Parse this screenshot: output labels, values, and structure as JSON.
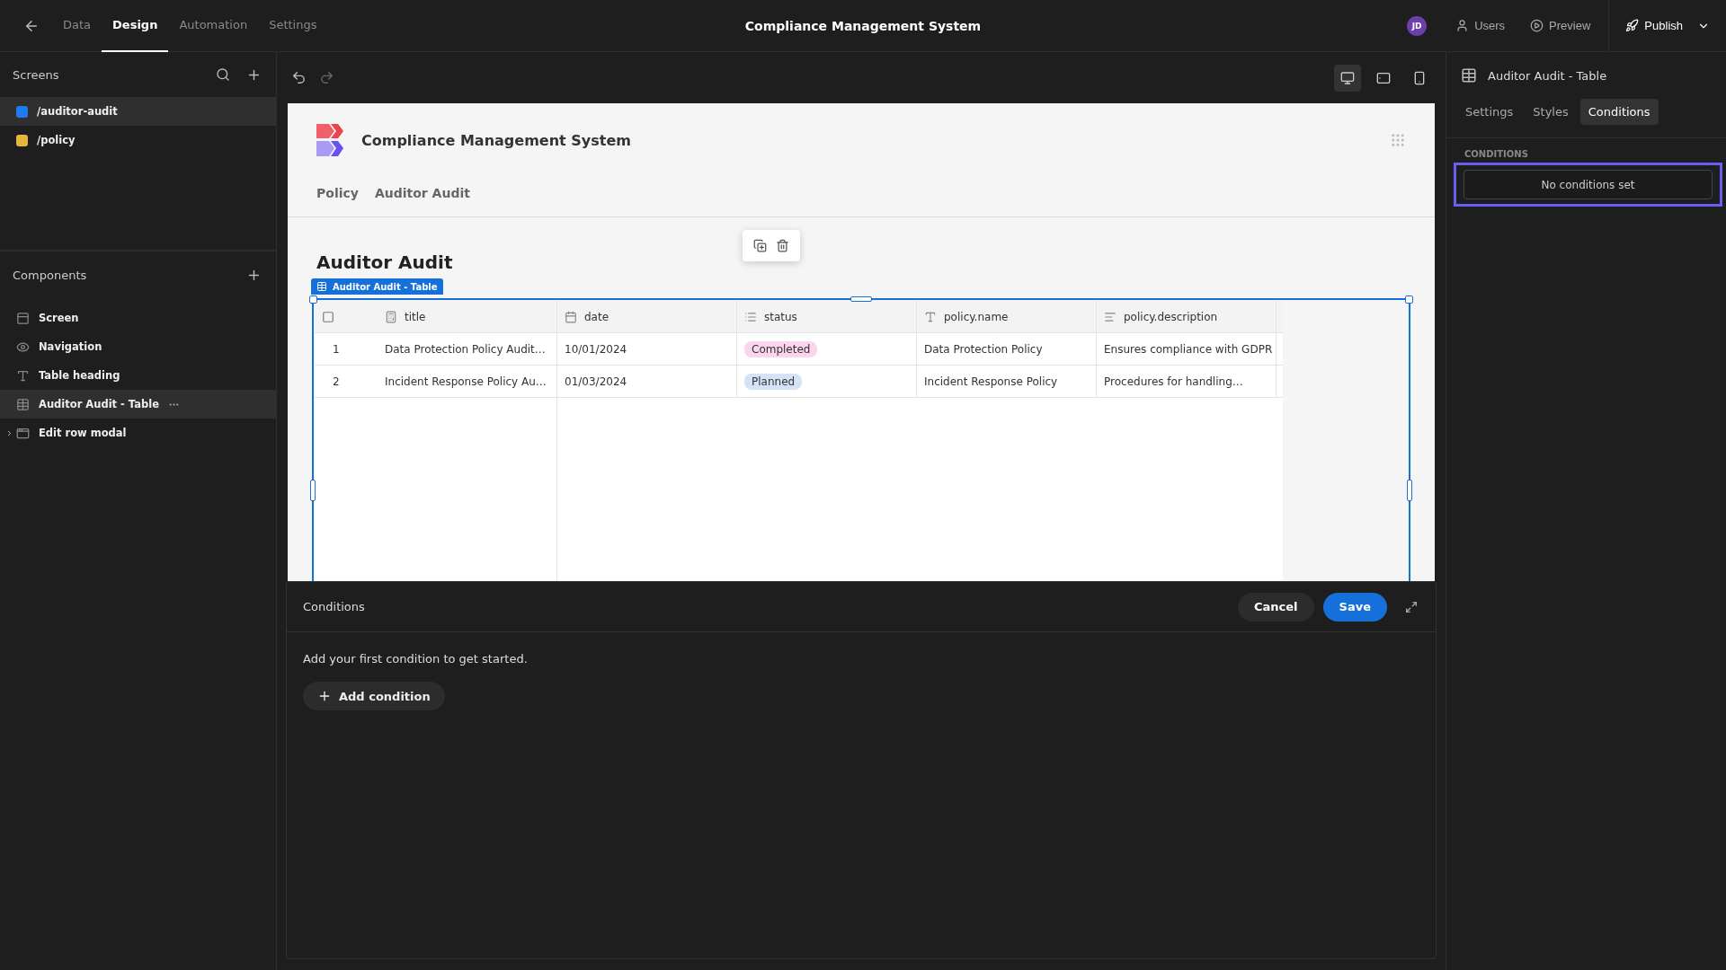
{
  "top_bar": {
    "tabs": [
      {
        "label": "Data",
        "selected": false
      },
      {
        "label": "Design",
        "selected": true
      },
      {
        "label": "Automation",
        "selected": false
      },
      {
        "label": "Settings",
        "selected": false
      }
    ],
    "title": "Compliance Management System",
    "avatar": "JD",
    "actions": [
      {
        "kind": "users",
        "label": "Users"
      },
      {
        "kind": "preview",
        "label": "Preview"
      },
      {
        "kind": "publish",
        "label": "Publish"
      }
    ]
  },
  "screens": {
    "title": "Screens",
    "items": [
      {
        "label": "/auditor-audit",
        "color": "#1f7cf0",
        "selected": true
      },
      {
        "label": "/policy",
        "color": "#e6b63c",
        "selected": false
      }
    ]
  },
  "components": {
    "title": "Components",
    "items": [
      {
        "kind": "screen",
        "label": "Screen",
        "selected": false
      },
      {
        "kind": "navigation",
        "label": "Navigation",
        "selected": false
      },
      {
        "kind": "heading",
        "label": "Table heading",
        "selected": false
      },
      {
        "kind": "table",
        "label": "Auditor Audit - Table",
        "selected": true
      },
      {
        "kind": "modal",
        "label": "Edit row modal",
        "selected": false,
        "expanded": false
      }
    ]
  },
  "devices": [
    {
      "kind": "desktop",
      "selected": true
    },
    {
      "kind": "tablet",
      "selected": false
    },
    {
      "kind": "mobile",
      "selected": false
    }
  ],
  "preview": {
    "app_title": "Compliance Management System",
    "nav": [
      "Policy",
      "Auditor Audit"
    ],
    "heading": "Auditor Audit",
    "selected_label": "Auditor Audit - Table",
    "table": {
      "select_all_checked": false,
      "columns": [
        {
          "kind": "number",
          "label": "title"
        },
        {
          "kind": "date",
          "label": "date"
        },
        {
          "kind": "options",
          "label": "status"
        },
        {
          "kind": "text",
          "label": "policy.name"
        },
        {
          "kind": "longform",
          "label": "policy.description"
        }
      ],
      "rows": [
        {
          "index": "1",
          "cells": [
            {
              "text": "Data Protection Policy Audit…"
            },
            {
              "text": "10/01/2024"
            },
            {
              "text": "Completed",
              "color": "#fbd5ee"
            },
            {
              "text": "Data Protection Policy"
            },
            {
              "text": "Ensures compliance with GDPR"
            }
          ]
        },
        {
          "index": "2",
          "cells": [
            {
              "text": "Incident Response Policy Au…"
            },
            {
              "text": "01/03/2024"
            },
            {
              "text": "Planned",
              "color": "#d6e3f7"
            },
            {
              "text": "Incident Response Policy"
            },
            {
              "text": "Procedures for handling…"
            }
          ]
        }
      ]
    }
  },
  "conditions_modal": {
    "title": "Conditions",
    "buttons": [
      {
        "kind": "secondary",
        "label": "Cancel"
      },
      {
        "kind": "primary",
        "label": "Save"
      }
    ],
    "hint": "Add your first condition to get started.",
    "add_button": "Add condition"
  },
  "right_panel": {
    "title": "Auditor Audit - Table",
    "tabs": [
      {
        "label": "Settings",
        "selected": false
      },
      {
        "label": "Styles",
        "selected": false
      },
      {
        "label": "Conditions",
        "selected": true
      }
    ],
    "section": "CONDITIONS",
    "empty": "No conditions set",
    "highlighted": true
  }
}
